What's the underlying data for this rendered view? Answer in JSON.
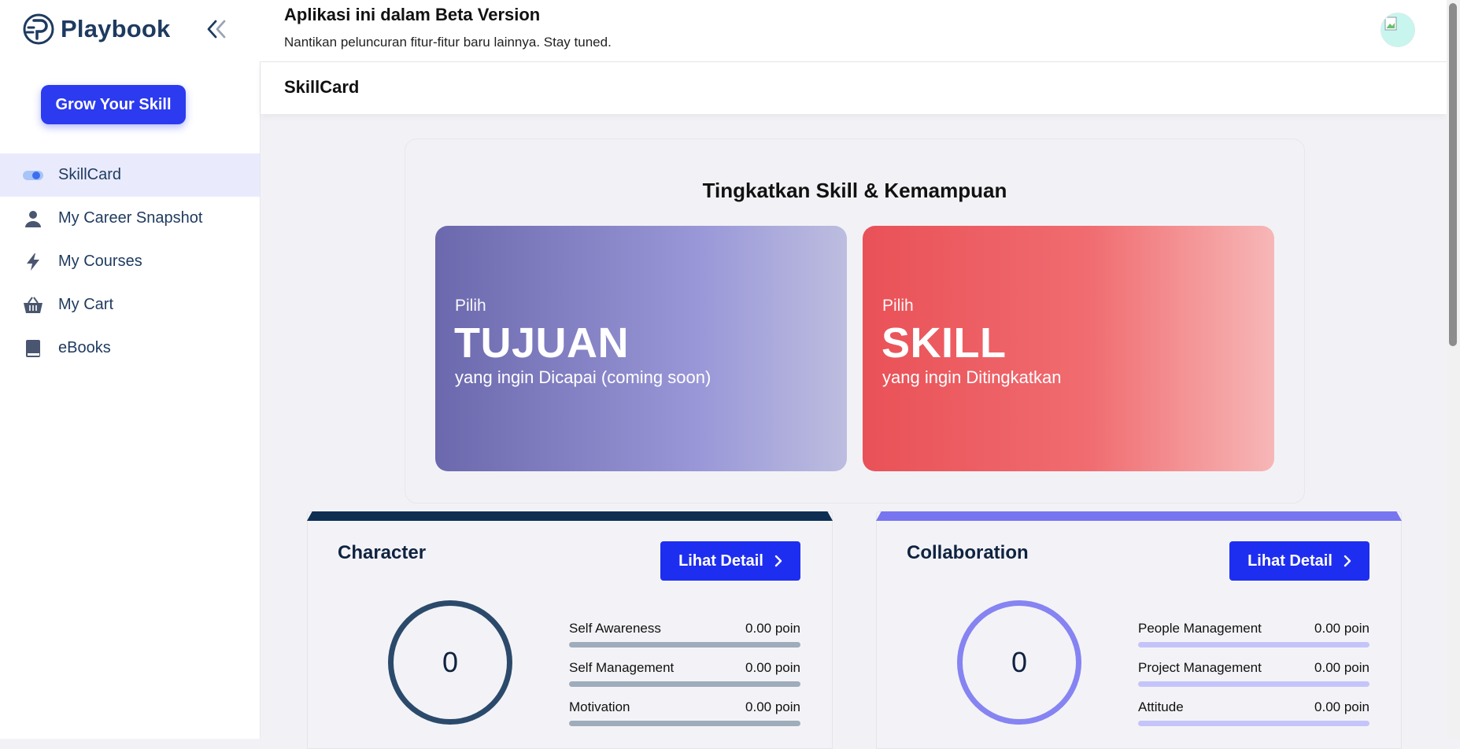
{
  "app": {
    "name": "Playbook"
  },
  "banner": {
    "title": "Aplikasi ini dalam Beta Version",
    "subtitle": "Nantikan peluncuran fitur-fitur baru lainnya. Stay tuned."
  },
  "sidebar": {
    "cta_label": "Grow Your Skill",
    "items": [
      {
        "label": "SkillCard",
        "icon": "toggle-icon",
        "active": true
      },
      {
        "label": "My Career Snapshot",
        "icon": "person-icon",
        "active": false
      },
      {
        "label": "My Courses",
        "icon": "lightning-icon",
        "active": false
      },
      {
        "label": "My Cart",
        "icon": "basket-icon",
        "active": false
      },
      {
        "label": "eBooks",
        "icon": "book-icon",
        "active": false
      }
    ]
  },
  "page": {
    "title": "SkillCard"
  },
  "hero": {
    "title": "Tingkatkan Skill & Kemampuan",
    "cards": [
      {
        "label": "Pilih",
        "big": "TUJUAN",
        "sub": "yang ingin Dicapai (coming soon)"
      },
      {
        "label": "Pilih",
        "big": "SKILL",
        "sub": "yang ingin Ditingkatkan"
      }
    ]
  },
  "skill_cards": [
    {
      "title": "Character",
      "button_label": "Lihat Detail",
      "score": "0",
      "accent": "#0e2f52",
      "ring_color": "#2b4a6b",
      "bar_color": "#9eacbb",
      "metrics": [
        {
          "name": "Self Awareness",
          "value": "0.00 poin"
        },
        {
          "name": "Self Management",
          "value": "0.00 poin"
        },
        {
          "name": "Motivation",
          "value": "0.00 poin"
        }
      ]
    },
    {
      "title": "Collaboration",
      "button_label": "Lihat Detail",
      "score": "0",
      "accent": "#7875f0",
      "ring_color": "#8683f2",
      "bar_color": "#c5c4fa",
      "metrics": [
        {
          "name": "People Management",
          "value": "0.00 poin"
        },
        {
          "name": "Project Management",
          "value": "0.00 poin"
        },
        {
          "name": "Attitude",
          "value": "0.00 poin"
        }
      ]
    }
  ],
  "colors": {
    "primary": "#2c3af0",
    "active_nav_bg": "#e9ebfd",
    "text_dark": "#1e3a5f"
  }
}
